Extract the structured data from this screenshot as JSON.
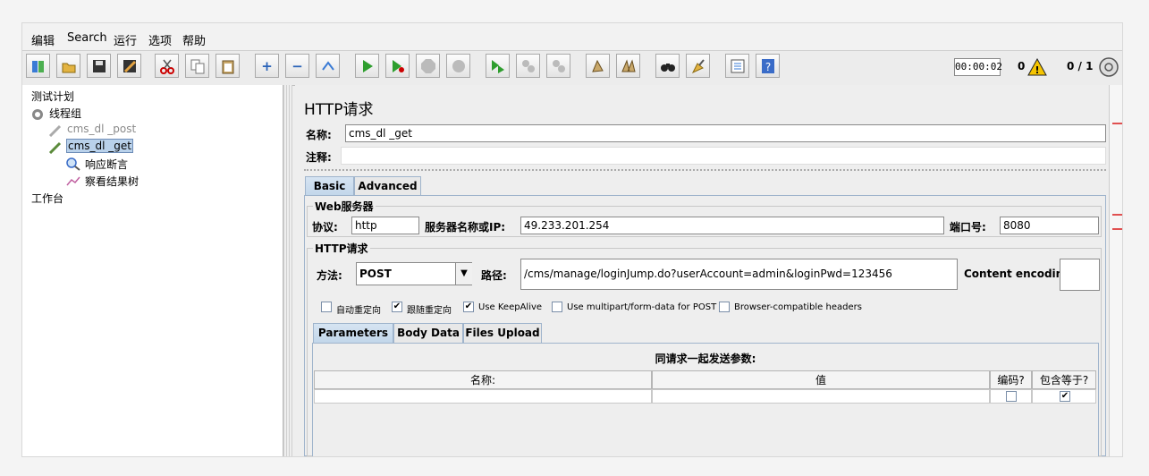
{
  "menu": [
    "编辑",
    "Search",
    "运行",
    "选项",
    "帮助"
  ],
  "toolbar": {
    "buttons": [
      "templates-icon",
      "open-icon",
      "save-icon",
      "save-as-icon",
      "cut-icon",
      "copy-icon",
      "paste-icon",
      "expand-icon",
      "collapse-icon",
      "toggle-icon",
      "start-icon",
      "start-no-pause-icon",
      "stop-icon",
      "shutdown-icon",
      "remote-start-icon",
      "remote-stop-icon",
      "remote-shutdown-icon",
      "clear-icon",
      "clear-all-icon",
      "search-icon",
      "reset-search-icon",
      "function-helper-icon",
      "help-icon"
    ],
    "timer": "00:00:02",
    "warning_count": "0",
    "threads": "0 / 1"
  },
  "tree": {
    "plan": "测试计划",
    "thread_group": "线程组",
    "sampler_post": "cms_dl _post",
    "sampler_get": "cms_dl _get",
    "assertion": "响应断言",
    "listener": "察看结果树",
    "workbench": "工作台"
  },
  "panel": {
    "title": "HTTP请求",
    "name_label": "名称:",
    "name_value": "cms_dl _get",
    "comment_label": "注释:",
    "comment_value": ""
  },
  "tabs": [
    "Basic",
    "Advanced"
  ],
  "web_server": {
    "group_title": "Web服务器",
    "protocol_label": "协议:",
    "protocol_value": "http",
    "server_label": "服务器名称或IP:",
    "server_value": "49.233.201.254",
    "port_label": "端口号:",
    "port_value": "8080"
  },
  "http_request": {
    "group_title": "HTTP请求",
    "method_label": "方法:",
    "method_value": "POST",
    "path_label": "路径:",
    "path_value": "/cms/manage/loginJump.do?userAccount=admin&loginPwd=123456",
    "encoding_label": "Content encoding:",
    "encoding_value": ""
  },
  "options": [
    {
      "label": "自动重定向",
      "checked": false
    },
    {
      "label": "跟随重定向",
      "checked": true
    },
    {
      "label": "Use KeepAlive",
      "checked": true
    },
    {
      "label": "Use multipart/form-data for POST",
      "checked": false
    },
    {
      "label": "Browser-compatible headers",
      "checked": false
    }
  ],
  "subtabs": [
    "Parameters",
    "Body Data",
    "Files Upload"
  ],
  "params": {
    "caption": "同请求一起发送参数:",
    "columns": [
      "名称:",
      "值",
      "编码?",
      "包含等于?"
    ],
    "row": {
      "encode": false,
      "include_equals": true
    }
  },
  "check_mark": "✔"
}
